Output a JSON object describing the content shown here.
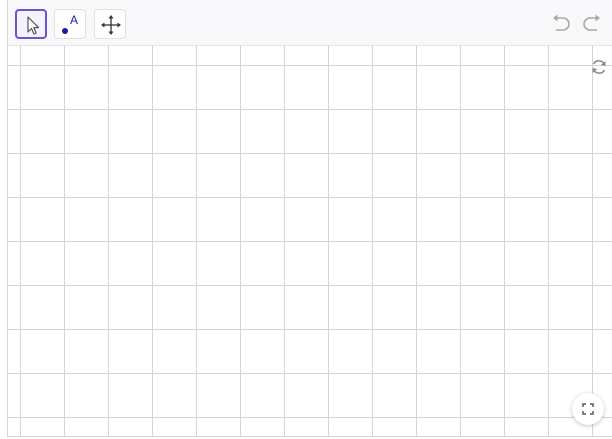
{
  "app": {
    "name": "geometry-graphics-view"
  },
  "toolbar": {
    "tools": [
      {
        "name": "move",
        "icon": "arrow-cursor-icon",
        "selected": true
      },
      {
        "name": "point",
        "icon": "point-a-icon",
        "selected": false,
        "glyph": "A"
      },
      {
        "name": "move-graphics-view",
        "icon": "four-way-arrow-icon",
        "selected": false
      }
    ],
    "undo_icon": "undo-icon",
    "redo_icon": "redo-icon"
  },
  "graphics_view": {
    "grid": true,
    "refresh_icon": "refresh-icon",
    "fullscreen_icon": "fullscreen-icon"
  },
  "colors": {
    "accent": "#6557d2",
    "point": "#1a1aa8",
    "grid_line": "#d4d4d4",
    "icon_gray": "#a8a8a8"
  }
}
